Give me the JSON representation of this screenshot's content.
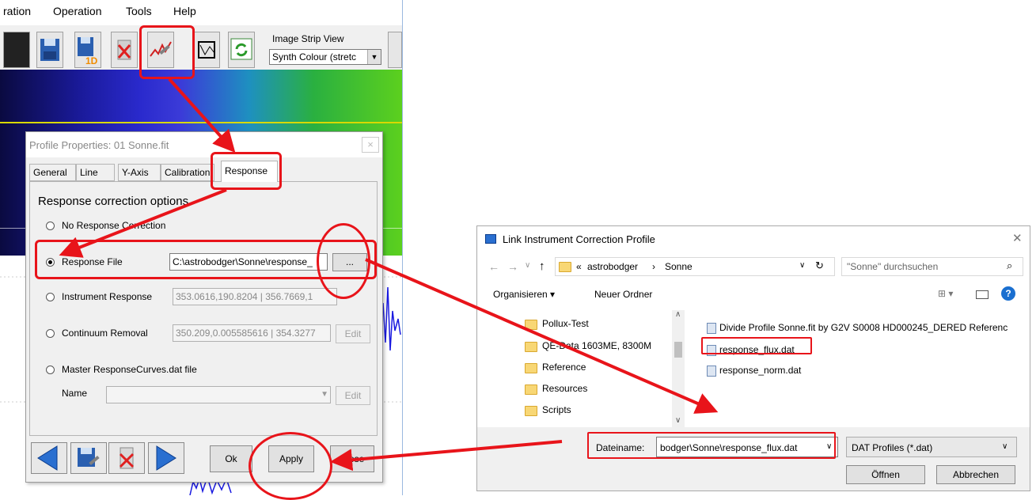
{
  "app": {
    "menu": [
      "ration",
      "Operation",
      "Tools",
      "Help"
    ],
    "strip_view": {
      "label": "Image Strip View",
      "value": "Synth Colour (stretc"
    }
  },
  "profile_dialog": {
    "title": "Profile Properties: 01 Sonne.fit",
    "close_glyph": "×",
    "tabs": [
      "General",
      "Line",
      "Y-Axis",
      "Calibration",
      "Response"
    ],
    "section_title": "Response correction options",
    "options": {
      "none": "No Response Correction",
      "file": "Response File",
      "instrument": "Instrument Response",
      "continuum": "Continuum Removal",
      "master": "Master ResponseCurves.dat file"
    },
    "file_path": "C:\\astrobodger\\Sonne\\response_",
    "browse_label": "...",
    "instrument_value": "353.0616,190.8204 | 356.7669,1",
    "continuum_value": "350.209,0.005585616 | 354.3277",
    "edit_label": "Edit",
    "name_label": "Name",
    "buttons": {
      "ok": "Ok",
      "apply": "Apply",
      "close": "Close"
    }
  },
  "file_dialog": {
    "title": "Link Instrument Correction Profile",
    "close_glyph": "✕",
    "breadcrumb": {
      "prefix": "«",
      "root": "astrobodger",
      "sep": "›",
      "current": "Sonne"
    },
    "search_placeholder": "\"Sonne\" durchsuchen",
    "toolbar": {
      "organize": "Organisieren ▾",
      "new_folder": "Neuer Ordner"
    },
    "folders": [
      "Pollux-Test",
      "QE-Data 1603ME, 8300M",
      "Reference",
      "Resources",
      "Scripts"
    ],
    "files": [
      "Divide Profile Sonne.fit by G2V S0008 HD000245_DERED Referenc",
      "response_flux.dat",
      "response_norm.dat"
    ],
    "filename_label": "Dateiname:",
    "filename_value": "bodger\\Sonne\\response_flux.dat",
    "filetype": "DAT Profiles (*.dat)",
    "open_label": "Öffnen",
    "cancel_label": "Abbrechen"
  },
  "colors": {
    "annotation": "#e8141a",
    "plot_line": "#1a1ae0",
    "accent": "#0078d7"
  }
}
